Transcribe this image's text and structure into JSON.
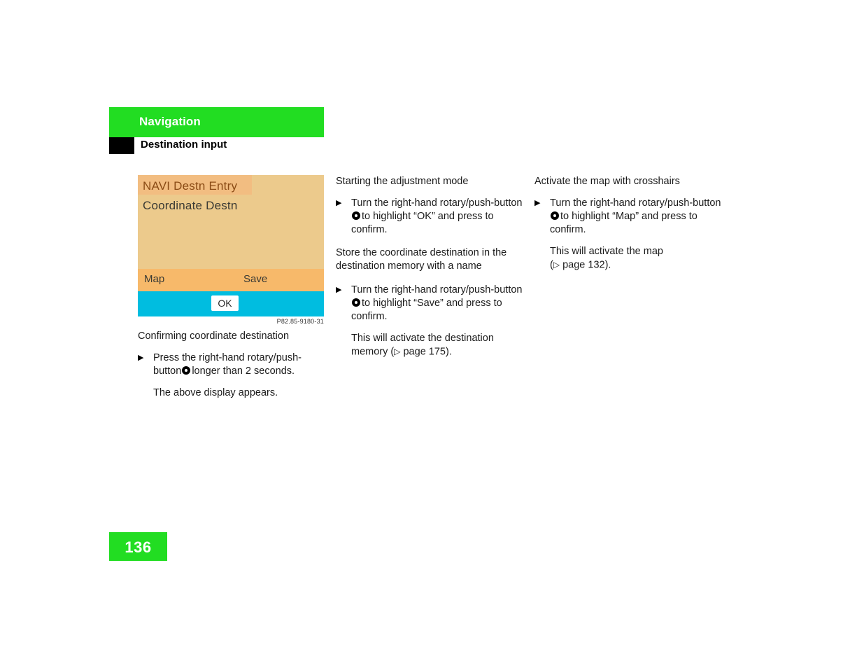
{
  "header": {
    "chapter": "Navigation",
    "section": "Destination input"
  },
  "figure": {
    "reference": "P82.85-9180-31",
    "caption": "Confirming coordinate destination",
    "screen": {
      "title": "NAVI Destn Entry",
      "line2": "Coordinate Destn",
      "softkey_left": "Map",
      "softkey_right": "Save",
      "ok_button": "OK"
    },
    "colors": {
      "titlebar": "#f2bd81",
      "body": "#ecca8c",
      "softbar": "#f7b96a",
      "okbar": "#00bde0",
      "ok_button_bg": "#ffffff"
    }
  },
  "columns": {
    "left": {
      "caption": "Confirming coordinate destination",
      "step": {
        "marker": "▶",
        "text_before_icon": "Press the right-hand rotary/push-button",
        "icon": "rotary-push-knob-icon",
        "text_after_icon": "longer than 2 seconds."
      },
      "note": "The above display appears."
    },
    "middle": {
      "heading1": "Starting the adjustment mode",
      "step1": {
        "marker": "▶",
        "text_before_icon": "Turn the right-hand rotary/push-button",
        "icon": "rotary-push-knob-icon",
        "text_after_icon": "to highlight “OK” and press to confirm."
      },
      "heading2": "Store the coordinate destination in the destination memory with a name",
      "step2": {
        "marker": "▶",
        "text_before_icon": "Turn the right-hand rotary/push-button",
        "icon": "rotary-push-knob-icon",
        "text_after_icon": "to highlight “Save” and press to confirm."
      },
      "note_before_ref": "This will activate the destination memory (",
      "note_ref_icon": "▷",
      "note_ref": " page 175",
      "note_after_ref": ")."
    },
    "right": {
      "heading1": "Activate the map with crosshairs",
      "step1": {
        "marker": "▶",
        "text_before_icon": "Turn the right-hand rotary/push-button",
        "icon": "rotary-push-knob-icon",
        "text_after_icon": "to highlight “Map” and press to confirm."
      },
      "note_line1": "This will activate the map",
      "note_before_ref": "(",
      "note_ref_icon": "▷",
      "note_ref": " page 132",
      "note_after_ref": ")."
    }
  },
  "footer": {
    "page_number": "136",
    "accent_color": "#22dd22"
  }
}
